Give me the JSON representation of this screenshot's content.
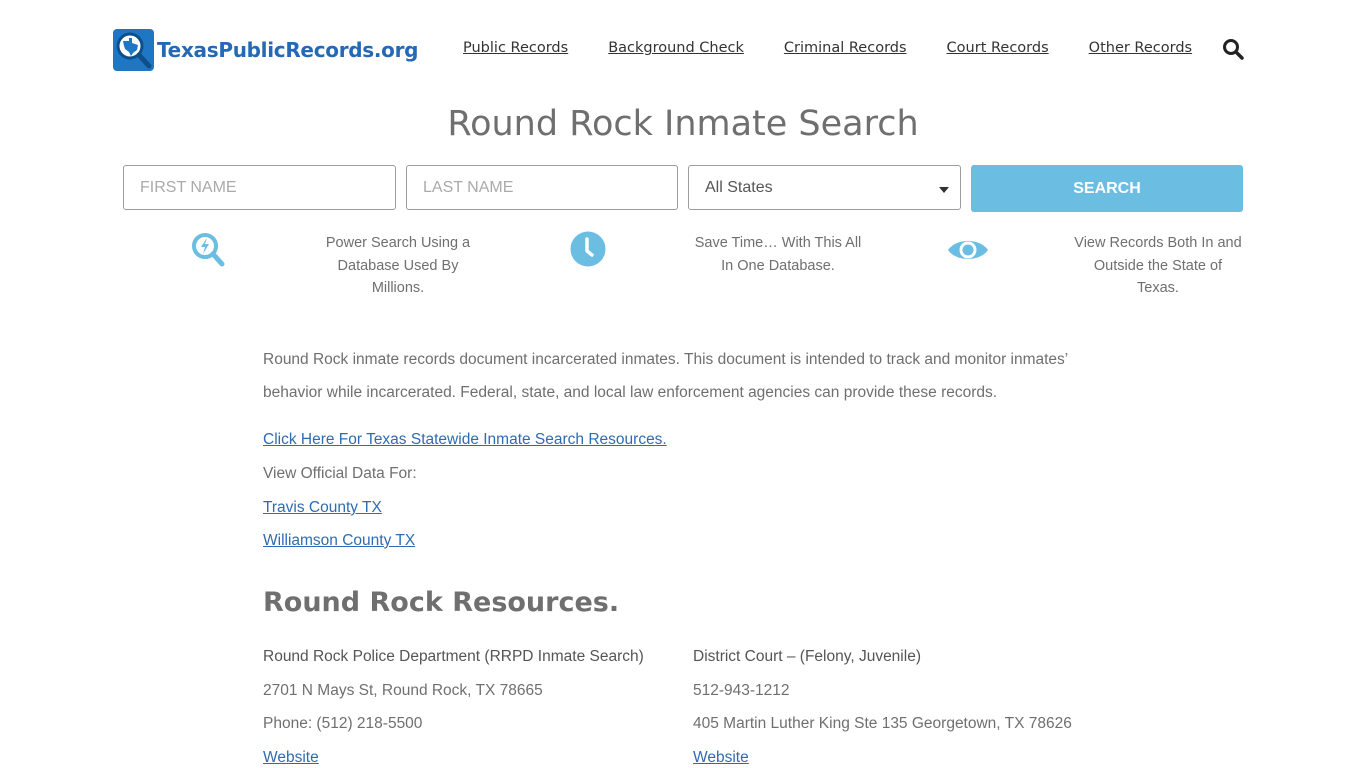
{
  "header": {
    "logo_text": "TexasPublicRecords.org",
    "nav": [
      "Public Records",
      "Background Check",
      "Criminal Records",
      "Court Records",
      "Other Records"
    ]
  },
  "page": {
    "title": "Round Rock Inmate Search"
  },
  "search_form": {
    "first_name_placeholder": "FIRST NAME",
    "last_name_placeholder": "LAST NAME",
    "state_selected": "All States",
    "button_label": "SEARCH"
  },
  "features": [
    {
      "icon": "magnifier-bolt-icon",
      "lines": [
        "Power Search Using a",
        "Database Used By",
        "Millions."
      ]
    },
    {
      "icon": "clock-icon",
      "lines": [
        "Save Time… With This All",
        "In One Database."
      ]
    },
    {
      "icon": "eye-icon",
      "lines": [
        "View Records Both In and",
        "Outside the State of",
        "Texas."
      ]
    }
  ],
  "content": {
    "intro": "Round Rock inmate records document incarcerated inmates. This document is intended to track and monitor inmates’ behavior while incarcerated. Federal, state, and local law enforcement agencies can provide these records.",
    "statewide_link": "Click Here For Texas Statewide Inmate Search Resources.",
    "view_official": "View Official Data For:",
    "county_links": [
      "Travis County TX",
      "Williamson County TX"
    ]
  },
  "resources": {
    "heading": "Round Rock Resources.",
    "items": [
      {
        "name": "Round Rock Police Department (RRPD Inmate Search)",
        "line1": "2701 N Mays St, Round Rock, TX 78665",
        "line2": "Phone: (512) 218-5500",
        "link": "Website"
      },
      {
        "name": "District Court – (Felony, Juvenile)",
        "line1": "512-943-1212",
        "line2": "405 Martin Luther King Ste 135 Georgetown, TX 78626",
        "link": "Website"
      }
    ]
  },
  "colors": {
    "brand_blue": "#1f76c2",
    "accent_light_blue": "#6bbde2",
    "link": "#2f6bb1",
    "text_gray": "#6f6f6f"
  }
}
